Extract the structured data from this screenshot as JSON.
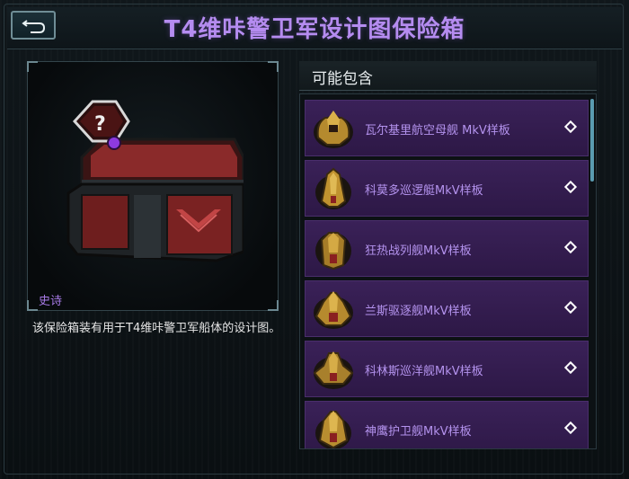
{
  "header": {
    "title": "T4维咔警卫军设计图保险箱",
    "back_icon": "back-arrow-icon"
  },
  "left": {
    "rarity": "史诗",
    "description": "该保险箱装有用于T4维咔警卫军船体的设计图。",
    "chest_badge_icon": "question-mark-icon"
  },
  "right": {
    "header": "可能包含",
    "items": [
      {
        "label": "瓦尔基里航空母舰 MkV样板",
        "icon": "ship-icon"
      },
      {
        "label": "科莫多巡逻艇MkV样板",
        "icon": "ship-icon"
      },
      {
        "label": "狂热战列舰MkV样板",
        "icon": "ship-icon"
      },
      {
        "label": "兰斯驱逐舰MkV样板",
        "icon": "ship-icon"
      },
      {
        "label": "科林斯巡洋舰MkV样板",
        "icon": "ship-icon"
      },
      {
        "label": "神鹰护卫舰MkV样板",
        "icon": "ship-icon"
      }
    ]
  },
  "colors": {
    "title": "#b58cf0",
    "item_bg": "#2d1846",
    "item_label": "#b493ee",
    "chest_red": "#8a2a2a"
  }
}
